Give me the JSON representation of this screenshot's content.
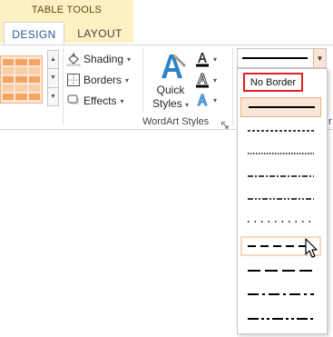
{
  "contextual_tab_group": "TABLE TOOLS",
  "tabs": [
    {
      "label": "DESIGN",
      "active": true
    },
    {
      "label": "LAYOUT",
      "active": false
    }
  ],
  "table_styles_group": {
    "commands": [
      {
        "label": "Shading",
        "icon": "paint-bucket-icon"
      },
      {
        "label": "Borders",
        "icon": "borders-grid-icon"
      },
      {
        "label": "Effects",
        "icon": "effects-icon"
      }
    ]
  },
  "wordart_group": {
    "quick_styles_label_1": "Quick",
    "quick_styles_label_2": "Styles",
    "group_label": "WordArt Styles"
  },
  "border_style": {
    "selected": "solid",
    "no_border_label": "No Border",
    "options": [
      "solid",
      "dashed-fine",
      "dotted",
      "dash-dot",
      "dash-dot-dot",
      "sparse-dots",
      "dashed",
      "long-dash",
      "long-dash-dot",
      "long-dash-dot-dot"
    ],
    "hovered": "dashed"
  },
  "colors": {
    "accent": "#2b579a",
    "selection_fill": "#fbe5d6",
    "selection_border": "#f3b07f",
    "highlight_red": "#e02020",
    "contextual_fill": "#fdf0c2"
  }
}
